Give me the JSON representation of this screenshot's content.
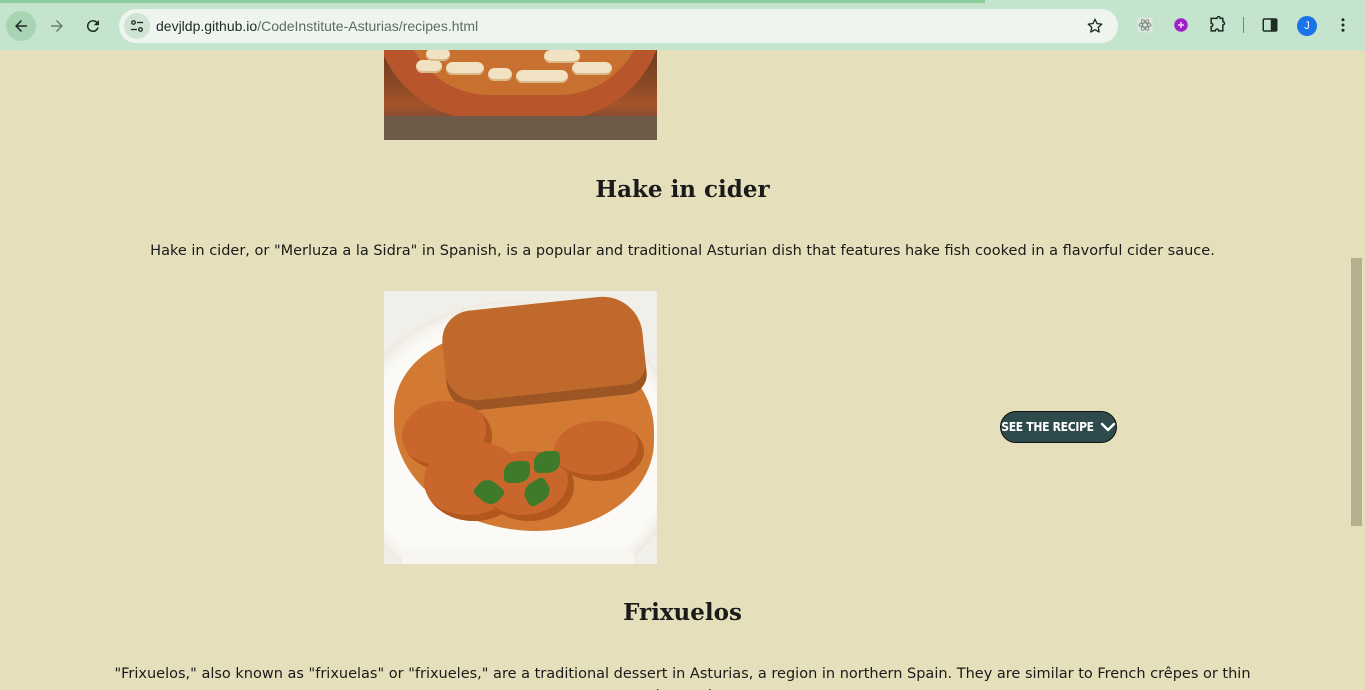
{
  "browser": {
    "url_host": "devjldp.github.io",
    "url_path": "/CodeInstitute-Asturias/recipes.html",
    "profile_initial": "J",
    "icons": [
      "back-icon",
      "forward-icon",
      "reload-icon",
      "site-info-icon",
      "star-icon",
      "react-devtools-icon",
      "extension-icon",
      "puzzle-icon",
      "side-panel-icon",
      "menu-icon"
    ]
  },
  "recipes": [
    {
      "title": "Hake in cider",
      "description": "Hake in cider, or \"Merluza a la Sidra\" in Spanish, is a popular and traditional Asturian dish that features hake fish cooked in a flavorful cider sauce.",
      "button_label": "SEE THE RECIPE"
    },
    {
      "title": "Frixuelos",
      "description": "\"Frixuelos,\" also known as \"frixuelas\" or \"frixueles,\" are a traditional dessert in Asturias, a region in northern Spain. They are similar to French crêpes or thin pancakes and are a"
    }
  ],
  "colors": {
    "page_bg": "#e6dfbb",
    "chrome_bg": "#c5e4cd",
    "button_bg": "#2f4a4c"
  }
}
